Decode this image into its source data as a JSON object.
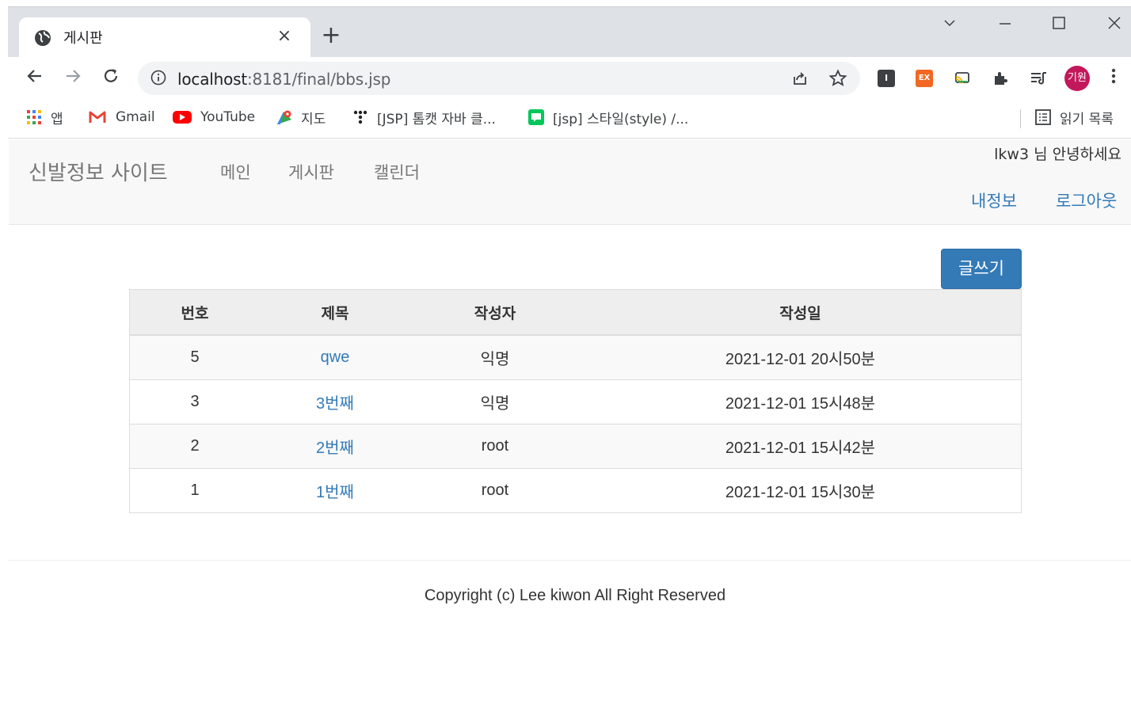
{
  "browser": {
    "tab_title": "게시판",
    "tab_close": "×",
    "new_tab": "+",
    "url_host": "localhost",
    "url_path": ":8181/final/bbs.jsp",
    "bookmarks": {
      "apps": "앱",
      "gmail": "Gmail",
      "youtube": "YouTube",
      "maps": "지도",
      "jsp_tomcat": "[JSP] 톰캣 자바 클...",
      "jsp_style": "[jsp] 스타일(style) /...",
      "reading_list": "읽기 목록"
    },
    "profile_initials": "기원",
    "extensions": [
      "I",
      "EX"
    ]
  },
  "site": {
    "brand": "신발정보 사이트",
    "nav": {
      "main": "메인",
      "board": "게시판",
      "calendar": "캘린더"
    },
    "greeting": "lkw3 님 안녕하세요",
    "my_info": "내정보",
    "logout": "로그아웃"
  },
  "board": {
    "write_button": "글쓰기",
    "headers": {
      "no": "번호",
      "title": "제목",
      "author": "작성자",
      "date": "작성일"
    },
    "rows": [
      {
        "no": "5",
        "title": "qwe",
        "author": "익명",
        "date": "2021-12-01 20시50분"
      },
      {
        "no": "3",
        "title": "3번째",
        "author": "익명",
        "date": "2021-12-01 15시48분"
      },
      {
        "no": "2",
        "title": "2번째",
        "author": "root",
        "date": "2021-12-01 15시42분"
      },
      {
        "no": "1",
        "title": "1번째",
        "author": "root",
        "date": "2021-12-01 15시30분"
      }
    ]
  },
  "footer": {
    "copyright": "Copyright (c) Lee kiwon All Right Reserved"
  },
  "colors": {
    "link": "#337ab7",
    "navbar_bg": "#f8f8f8",
    "profile": "#c2185b"
  }
}
